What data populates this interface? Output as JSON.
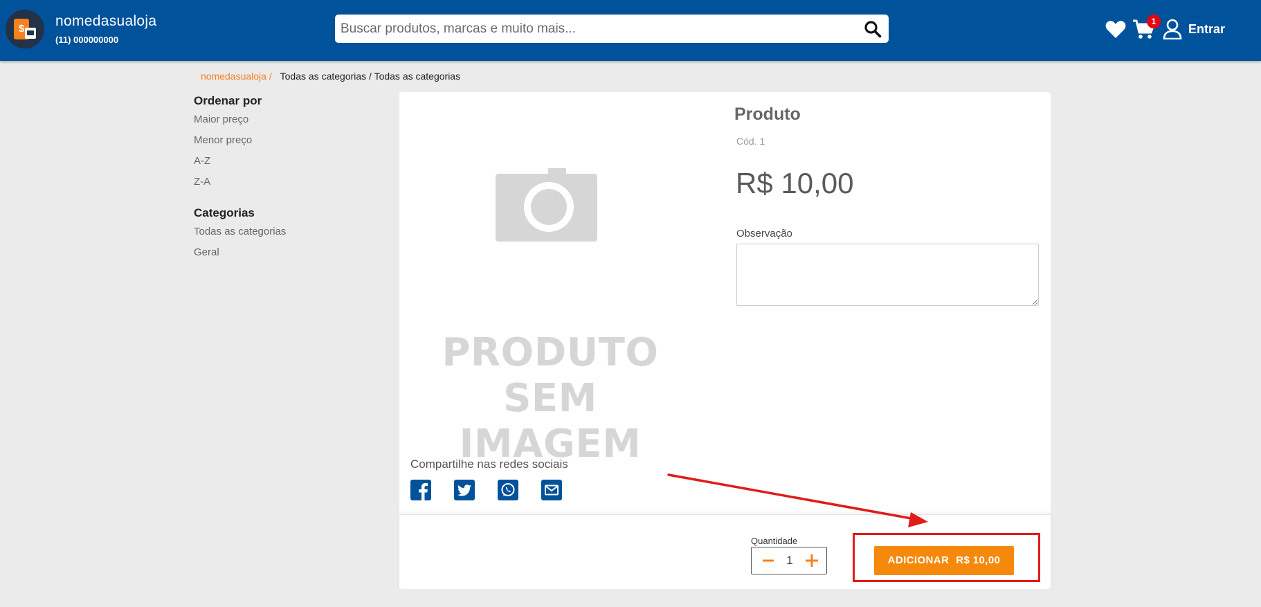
{
  "header": {
    "store_name": "nomedasualoja",
    "store_phone": "(11) 000000000",
    "search_placeholder": "Buscar produtos, marcas e muito mais...",
    "cart_count": "1",
    "login_label": "Entrar",
    "logo_symbol": "$"
  },
  "breadcrumb": {
    "home": "nomedasualoja /",
    "rest": "Todas as categorias / Todas as categorias"
  },
  "sidebar": {
    "sort_title": "Ordenar por",
    "sort_options": [
      "Maior preço",
      "Menor preço",
      "A-Z",
      "Z-A"
    ],
    "categories_title": "Categorias",
    "categories": [
      "Todas as categorias",
      "Geral"
    ]
  },
  "product": {
    "no_image_line1": "PRODUTO",
    "no_image_line2": "SEM IMAGEM",
    "title": "Produto",
    "code": "Cód. 1",
    "price": "R$ 10,00",
    "obs_label": "Observação",
    "share_title": "Compartilhe nas redes sociais",
    "share_icons": [
      "facebook-icon",
      "twitter-icon",
      "whatsapp-icon",
      "email-icon"
    ],
    "quantity_label": "Quantidade",
    "quantity_value": "1",
    "add_label": "ADICIONAR",
    "add_price": "R$ 10,00"
  },
  "colors": {
    "header_bg": "#00529b",
    "accent": "#f5811f",
    "button": "#f5890c",
    "annotation": "#e21b1b"
  }
}
